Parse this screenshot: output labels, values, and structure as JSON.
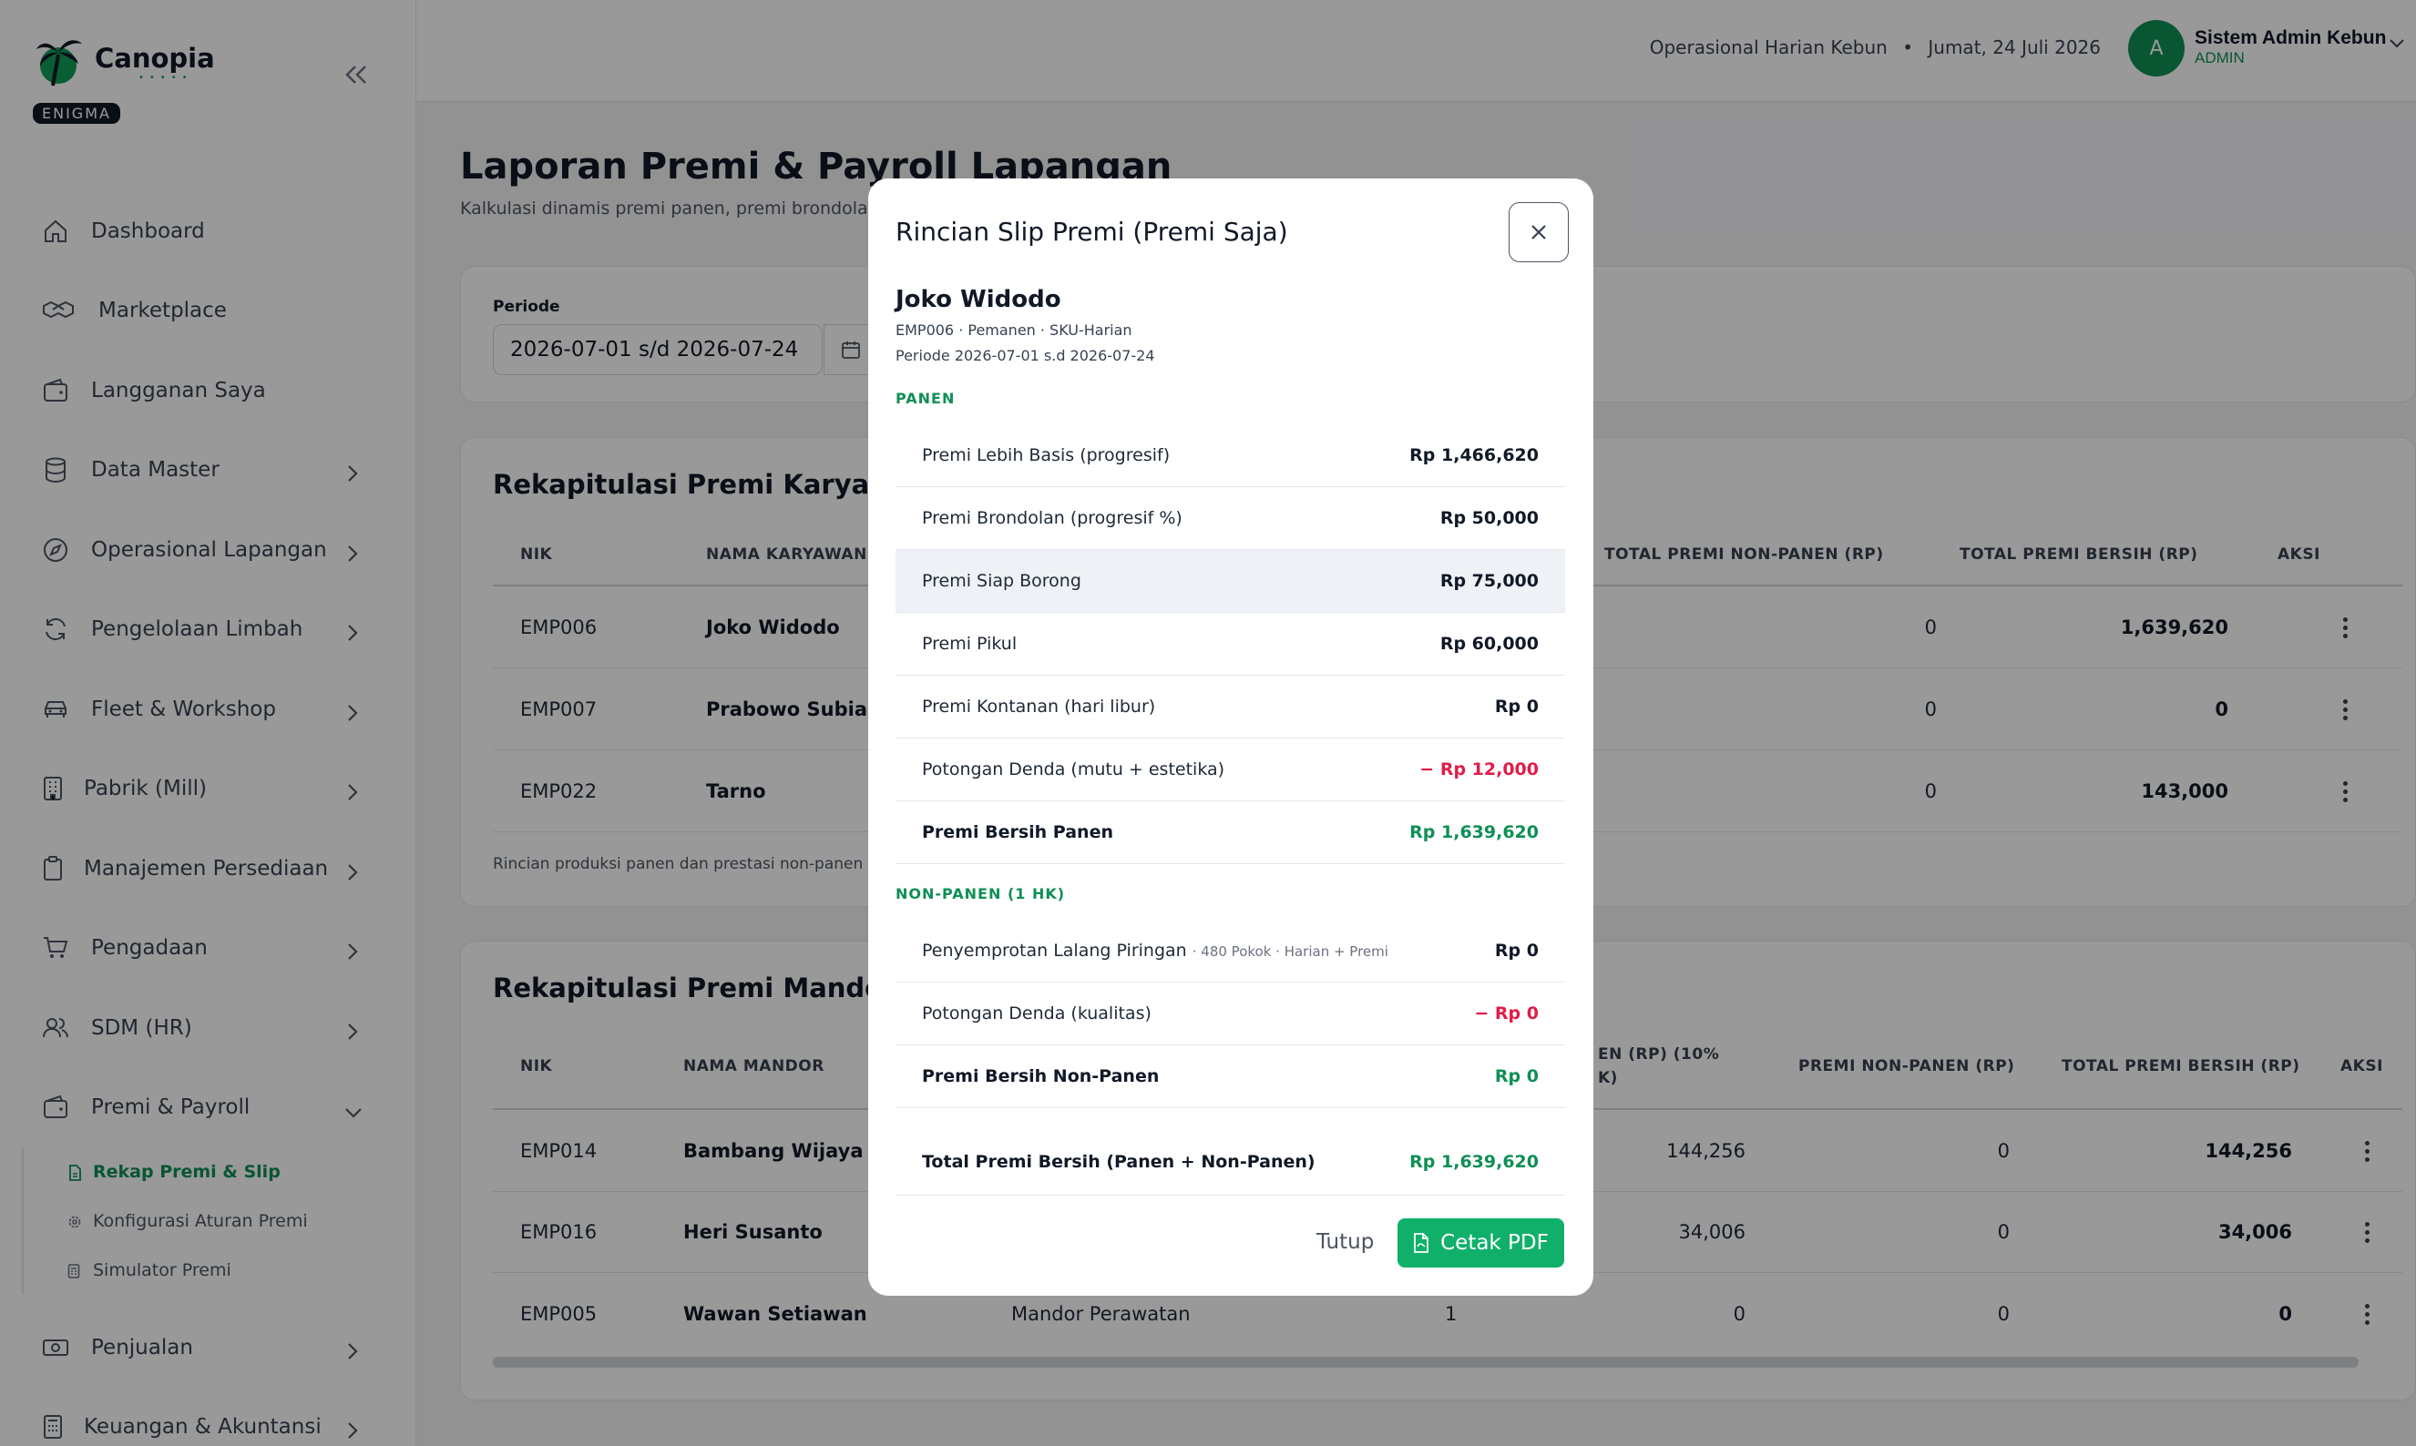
{
  "brand": {
    "name": "Canopia",
    "tag": "ENIGMA"
  },
  "sidebar": {
    "items": [
      {
        "label": "Dashboard"
      },
      {
        "label": "Marketplace"
      },
      {
        "label": "Langganan Saya"
      },
      {
        "label": "Data Master"
      },
      {
        "label": "Operasional Lapangan"
      },
      {
        "label": "Pengelolaan Limbah"
      },
      {
        "label": "Fleet & Workshop"
      },
      {
        "label": "Pabrik (Mill)"
      },
      {
        "label": "Manajemen Persediaan"
      },
      {
        "label": "Pengadaan"
      },
      {
        "label": "SDM (HR)"
      },
      {
        "label": "Premi & Payroll"
      },
      {
        "label": "Penjualan"
      },
      {
        "label": "Keuangan & Akuntansi"
      }
    ],
    "sub_items": [
      {
        "label": "Rekap Premi & Slip"
      },
      {
        "label": "Konfigurasi Aturan Premi"
      },
      {
        "label": "Simulator Premi"
      }
    ]
  },
  "header": {
    "context": "Operasional Harian Kebun",
    "date": "Jumat, 24 Juli 2026",
    "separator": "•",
    "user_initial": "A",
    "user_name": "Sistem Admin Kebun",
    "user_role": "ADMIN"
  },
  "page": {
    "title": "Laporan Premi & Payroll Lapangan",
    "subtitle": "Kalkulasi dinamis premi panen, premi brondolan, d"
  },
  "filter": {
    "label": "Periode",
    "value": "2026-07-01 s/d 2026-07-24"
  },
  "karyawan": {
    "title": "Rekapitulasi Premi Karyawan",
    "headers": {
      "nik": "NIK",
      "nama": "NAMA KARYAWAN",
      "total_non_panen": "TOTAL PREMI NON-PANEN (RP)",
      "total_bersih": "TOTAL PREMI BERSIH (RP)",
      "aksi": "AKSI"
    },
    "rows": [
      {
        "nik": "EMP006",
        "nama": "Joko Widodo",
        "non_panen": "0",
        "bersih": "1,639,620"
      },
      {
        "nik": "EMP007",
        "nama": "Prabowo Subianto",
        "non_panen": "0",
        "bersih": "0"
      },
      {
        "nik": "EMP022",
        "nama": "Tarno",
        "non_panen": "0",
        "bersih": "143,000"
      }
    ],
    "note": "Rincian produksi panen dan prestasi non-panen per a"
  },
  "mandor": {
    "title": "Rekapitulasi Premi Mandor",
    "headers": {
      "nik": "NIK",
      "nama": "NAMA MANDOR",
      "partial_line1": "EN (RP) (10%",
      "partial_line2": "K)",
      "non_panen": "PREMI NON-PANEN (RP)",
      "total_bersih": "TOTAL PREMI BERSIH (RP)",
      "aksi": "AKSI"
    },
    "rows": [
      {
        "nik": "EMP014",
        "nama": "Bambang Wijaya",
        "jabatan": "",
        "count": "",
        "partial": "144,256",
        "non_panen": "0",
        "bersih": "144,256"
      },
      {
        "nik": "EMP016",
        "nama": "Heri Susanto",
        "jabatan": "",
        "count": "",
        "partial": "34,006",
        "non_panen": "0",
        "bersih": "34,006"
      },
      {
        "nik": "EMP005",
        "nama": "Wawan Setiawan",
        "jabatan": "Mandor Perawatan",
        "count": "1",
        "partial": "0",
        "non_panen": "0",
        "bersih": "0"
      }
    ]
  },
  "modal": {
    "title": "Rincian Slip Premi (Premi Saja)",
    "employee_name": "Joko Widodo",
    "meta_line1": "EMP006 · Pemanen · SKU-Harian",
    "meta_line2": "Periode 2026-07-01 s.d 2026-07-24",
    "section_panen": "PANEN",
    "panen_rows": [
      {
        "label": "Premi Lebih Basis (progresif)",
        "value": "Rp 1,466,620"
      },
      {
        "label": "Premi Brondolan (progresif %)",
        "value": "Rp 50,000"
      },
      {
        "label": "Premi Siap Borong",
        "value": "Rp 75,000"
      },
      {
        "label": "Premi Pikul",
        "value": "Rp 60,000"
      },
      {
        "label": "Premi Kontanan (hari libur)",
        "value": "Rp 0"
      },
      {
        "label": "Potongan Denda (mutu + estetika)",
        "value": "− Rp 12,000"
      },
      {
        "label": "Premi Bersih Panen",
        "value": "Rp 1,639,620"
      }
    ],
    "section_non_panen": "NON-PANEN (1 HK)",
    "non_panen_rows": [
      {
        "label": "Penyemprotan Lalang Piringan",
        "detail": "· 480 Pokok · Harian + Premi",
        "value": "Rp 0"
      },
      {
        "label": "Potongan Denda (kualitas)",
        "value": "− Rp 0"
      },
      {
        "label": "Premi Bersih Non-Panen",
        "value": "Rp 0"
      }
    ],
    "total": {
      "label": "Total Premi Bersih (Panen + Non-Panen)",
      "value": "Rp 1,639,620"
    },
    "btn_close": "Tutup",
    "btn_print": "Cetak PDF"
  },
  "colors": {
    "accent": "#0f8f55",
    "danger": "#e11d48",
    "button": "#10b06b"
  }
}
